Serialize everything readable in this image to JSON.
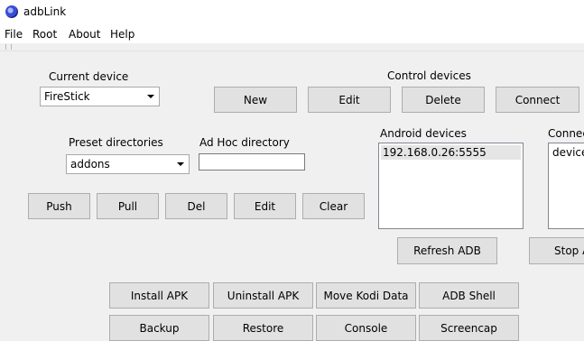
{
  "window": {
    "title": "adbLink"
  },
  "menu": [
    "File",
    "Root",
    "About",
    "Help"
  ],
  "current_device": {
    "label": "Current device",
    "value": "FireStick"
  },
  "control_devices": {
    "label": "Control devices",
    "buttons": [
      "New",
      "Edit",
      "Delete",
      "Connect"
    ]
  },
  "preset_directories": {
    "label": "Preset directories",
    "value": "addons"
  },
  "adhoc_directory": {
    "label": "Ad Hoc directory",
    "value": ""
  },
  "file_buttons": [
    "Push",
    "Pull",
    "Del",
    "Edit",
    "Clear"
  ],
  "android_devices": {
    "label": "Android devices",
    "items": [
      "192.168.0.26:5555"
    ]
  },
  "connected": {
    "label": "Connec",
    "items": [
      "device"
    ]
  },
  "refresh_adb": "Refresh ADB",
  "stop_adb": "Stop A",
  "actions_row1": [
    "Install APK",
    "Uninstall APK",
    "Move Kodi Data",
    "ADB Shell"
  ],
  "actions_row2": [
    "Backup",
    "Restore",
    "Console",
    "Screencap"
  ]
}
